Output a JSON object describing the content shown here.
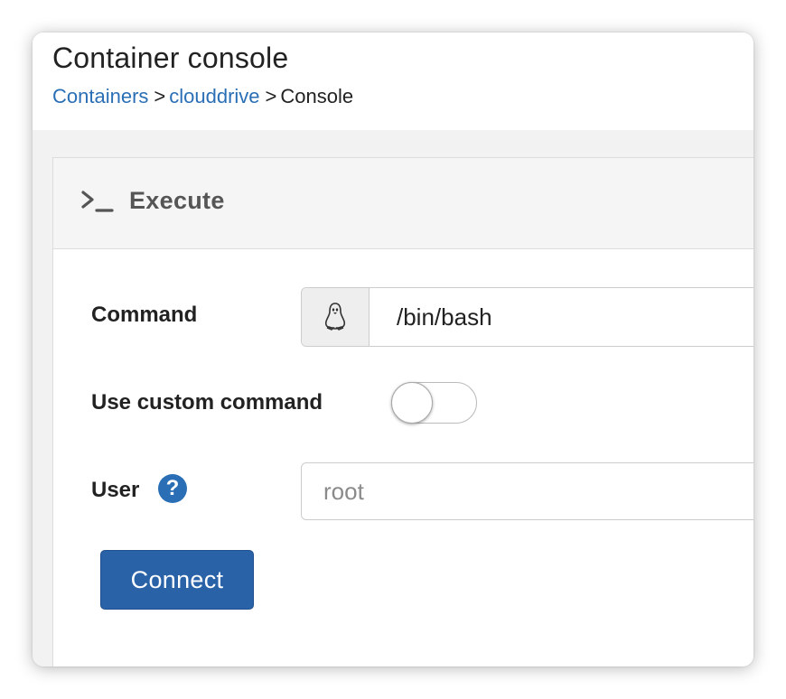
{
  "header": {
    "title": "Container console",
    "breadcrumb": {
      "items": [
        "Containers",
        "clouddrive"
      ],
      "separator": ">",
      "current": "Console"
    }
  },
  "panel": {
    "icon": "terminal-icon",
    "title": "Execute"
  },
  "form": {
    "command": {
      "label": "Command",
      "icon": "linux-penguin-icon",
      "value": "/bin/bash"
    },
    "custom_command": {
      "label": "Use custom command",
      "enabled": false
    },
    "user": {
      "label": "User",
      "help_icon": "question-circle-icon",
      "help_glyph": "?",
      "value": "",
      "placeholder": "root"
    },
    "connect_label": "Connect"
  },
  "colors": {
    "link": "#2a6fb6",
    "primary_button": "#2a62a8",
    "panel_heading_bg": "#f5f5f5",
    "page_bg": "#f2f2f2"
  }
}
